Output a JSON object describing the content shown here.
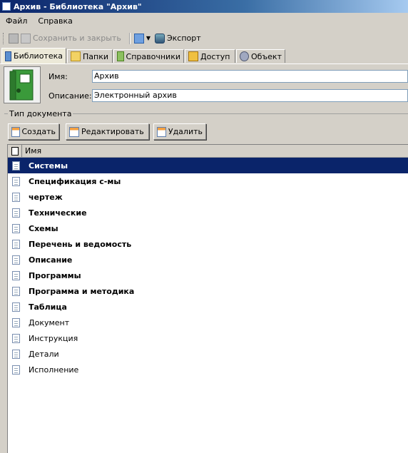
{
  "window": {
    "title": "Архив - Библиотека \"Архив\""
  },
  "menu": {
    "items": [
      "Файл",
      "Справка"
    ]
  },
  "toolbar": {
    "save_close": "Сохранить и закрыть",
    "export": "Экспорт"
  },
  "tabs": [
    "Библиотека",
    "Папки",
    "Справочники",
    "Доступ",
    "Объект"
  ],
  "form": {
    "name_label": "Имя:",
    "name_value": "Архив",
    "desc_label": "Описание:",
    "desc_value": "Электронный архив"
  },
  "doctype": {
    "group_title": "Тип документа",
    "create": "Создать",
    "edit": "Редактировать",
    "delete": "Удалить",
    "column_name": "Имя",
    "rows": [
      {
        "label": "Системы",
        "bold": true,
        "selected": true
      },
      {
        "label": "Спецификация с-мы",
        "bold": true
      },
      {
        "label": "чертеж",
        "bold": true
      },
      {
        "label": "Технические",
        "bold": true
      },
      {
        "label": "Схемы",
        "bold": true
      },
      {
        "label": "Перечень и ведомость",
        "bold": true
      },
      {
        "label": "Описание",
        "bold": true
      },
      {
        "label": "Программы",
        "bold": true
      },
      {
        "label": "Программа и методика",
        "bold": true
      },
      {
        "label": "Таблица",
        "bold": true
      },
      {
        "label": "Документ",
        "bold": false
      },
      {
        "label": "Инструкция",
        "bold": false
      },
      {
        "label": "Детали",
        "bold": false
      },
      {
        "label": "Исполнение",
        "bold": false
      }
    ]
  },
  "colors": {
    "selection": "#0a246a",
    "window_bg": "#d4d0c8"
  }
}
